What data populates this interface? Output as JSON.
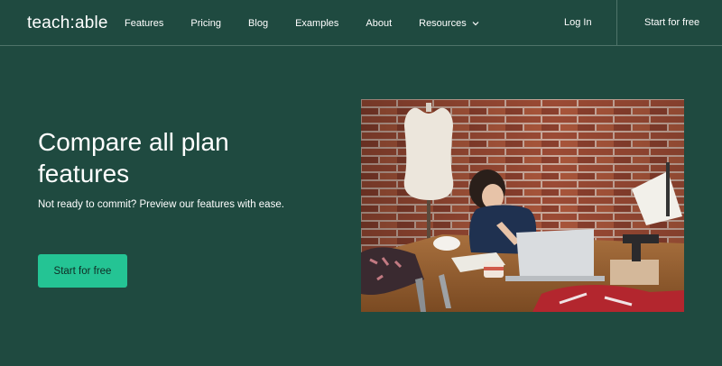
{
  "header": {
    "logo": "teach:able",
    "nav": [
      {
        "label": "Features"
      },
      {
        "label": "Pricing"
      },
      {
        "label": "Blog"
      },
      {
        "label": "Examples"
      },
      {
        "label": "About"
      },
      {
        "label": "Resources",
        "icon": "chevron-down-icon"
      }
    ],
    "login": "Log In",
    "cta": "Start for free"
  },
  "hero": {
    "title": "Compare all plan features",
    "subtitle": "Not ready to commit? Preview our features with ease.",
    "button": "Start for free",
    "image": "photo-woman-sewing-workshop"
  },
  "colors": {
    "background": "#1f4a40",
    "accent": "#24c494",
    "divider": "#4f7369",
    "text": "#ffffff"
  }
}
